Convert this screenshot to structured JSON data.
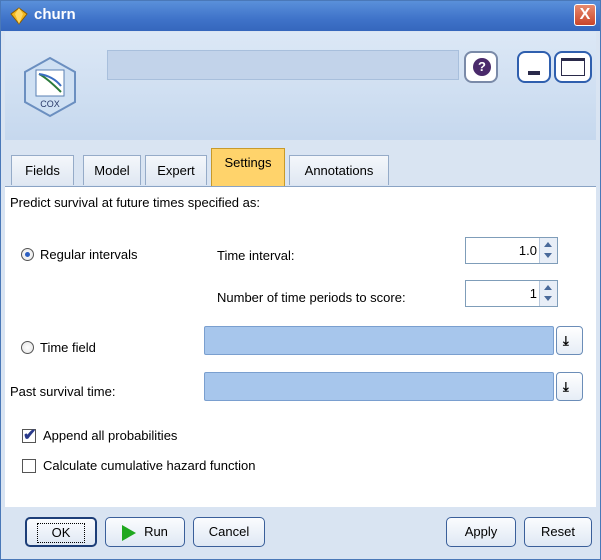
{
  "window": {
    "title": "churn",
    "close_glyph": "X"
  },
  "header": {
    "node_icon_label": "COX",
    "help_glyph": "?"
  },
  "tabs": [
    {
      "label": "Fields",
      "active": false
    },
    {
      "label": "Model",
      "active": false
    },
    {
      "label": "Expert",
      "active": false
    },
    {
      "label": "Settings",
      "active": true
    },
    {
      "label": "Annotations",
      "active": false
    }
  ],
  "settings": {
    "intro": "Predict survival at future times specified as:",
    "regular_intervals_label": "Regular intervals",
    "regular_intervals_selected": true,
    "time_interval_label": "Time interval:",
    "time_interval_value": "1.0",
    "num_periods_label": "Number of time periods to score:",
    "num_periods_value": "1",
    "time_field_label": "Time field",
    "time_field_selected": false,
    "time_field_value": "",
    "past_survival_label": "Past survival time:",
    "past_survival_value": "",
    "append_probs_label": "Append all probabilities",
    "append_probs_checked": true,
    "cum_hazard_label": "Calculate cumulative hazard function",
    "cum_hazard_checked": false
  },
  "footer": {
    "ok_label": "OK",
    "run_label": "Run",
    "cancel_label": "Cancel",
    "apply_label": "Apply",
    "reset_label": "Reset"
  },
  "colors": {
    "active_tab": "#ffd36b",
    "field_fill": "#a7c6ec",
    "titlebar": "#3f73c9"
  }
}
